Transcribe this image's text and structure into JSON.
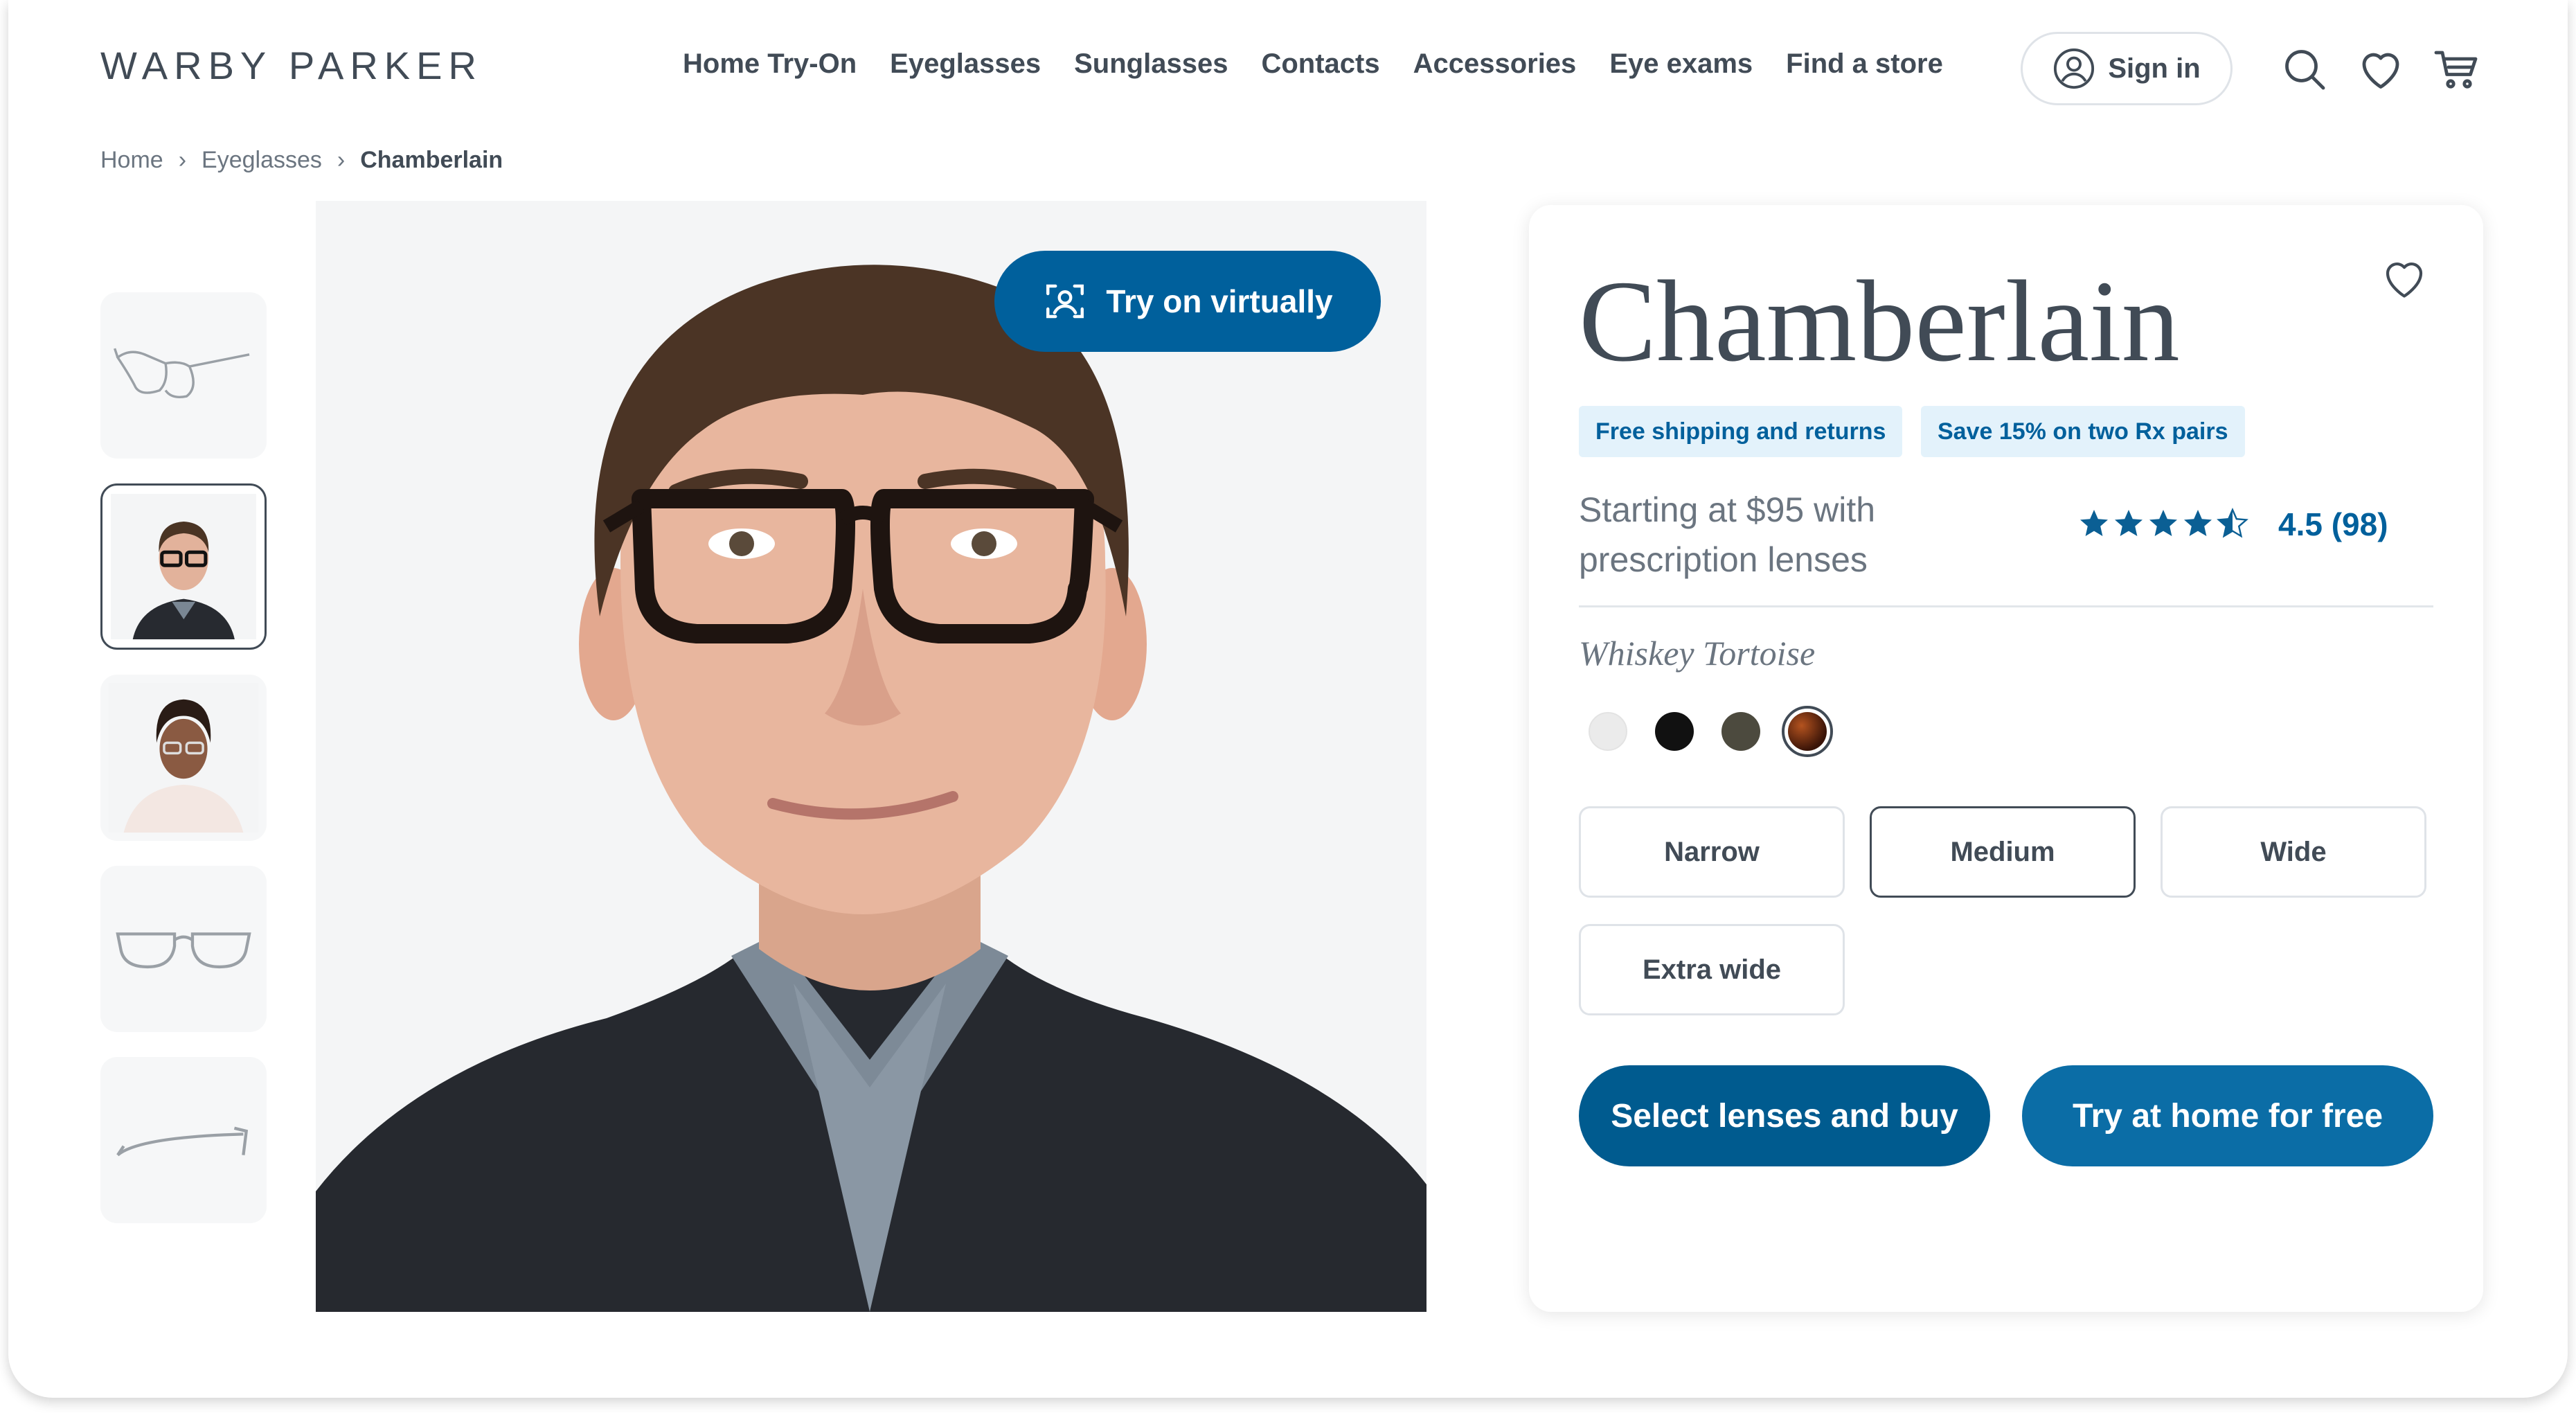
{
  "header": {
    "logo": "WARBY PARKER",
    "nav": [
      "Home Try-On",
      "Eyeglasses",
      "Sunglasses",
      "Contacts",
      "Accessories",
      "Eye exams",
      "Find a store"
    ],
    "sign_in": "Sign in",
    "icons": [
      "search-icon",
      "heart-icon",
      "cart-icon"
    ]
  },
  "breadcrumb": {
    "items": [
      "Home",
      "Eyeglasses"
    ],
    "current": "Chamberlain"
  },
  "gallery": {
    "thumbnails": [
      "glasses-angle-view",
      "model-man-wearing",
      "model-woman-wearing",
      "glasses-front-view",
      "glasses-side-view"
    ],
    "selected_index": 1,
    "try_on_label": "Try on virtually"
  },
  "product": {
    "name": "Chamberlain",
    "badges": [
      "Free shipping and returns",
      "Save 15% on two Rx pairs"
    ],
    "price_line1": "Starting at $95 with",
    "price_line2": "prescription lenses",
    "rating_value": 4.5,
    "rating_text": "4.5 (98)",
    "color_name": "Whiskey Tortoise",
    "swatches": [
      "#ebebeb",
      "#111111",
      "#4c4a3e",
      "#6b2e14"
    ],
    "selected_swatch": 3,
    "sizes": [
      "Narrow",
      "Medium",
      "Wide",
      "Extra wide"
    ],
    "selected_size": "Medium",
    "buy_label": "Select lenses and buy",
    "home_try_label": "Try at home for free"
  },
  "colors": {
    "primary_dark": "#00609c",
    "primary": "#0b6da6",
    "text": "#414b56",
    "badge_bg": "#e3f2fb"
  }
}
